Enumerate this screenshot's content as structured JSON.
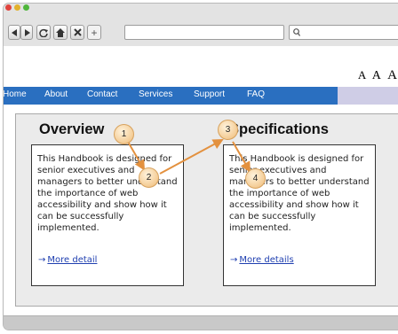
{
  "browser": {
    "new_tab_symbol": "+",
    "search_symbol": "Q",
    "icons": [
      "back-icon",
      "forward-icon",
      "reload-icon",
      "home-icon",
      "stop-icon",
      "search-icon"
    ]
  },
  "page": {
    "text_size_controls": [
      "A",
      "A",
      "A"
    ],
    "nav": [
      "Home",
      "About",
      "Contact",
      "Services",
      "Support",
      "FAQ"
    ],
    "colors": {
      "nav_background": "#2a6fc0",
      "link": "#1f3fb0",
      "badge": "#f4cc95",
      "arrow": "#e3913f"
    },
    "cards": [
      {
        "heading": "Overview",
        "body": "This Handbook is designed for senior executives and managers to better understand the importance of web accessibility and show how it can be successfully implemented.",
        "link": "More detail"
      },
      {
        "heading": "Specifications",
        "body": "This Handbook is designed for senior executives and managers to better understand the importance of web accessibility and show how it can be successfully implemented.",
        "link": "More details"
      }
    ]
  },
  "annotations": [
    "1",
    "2",
    "3",
    "4"
  ]
}
